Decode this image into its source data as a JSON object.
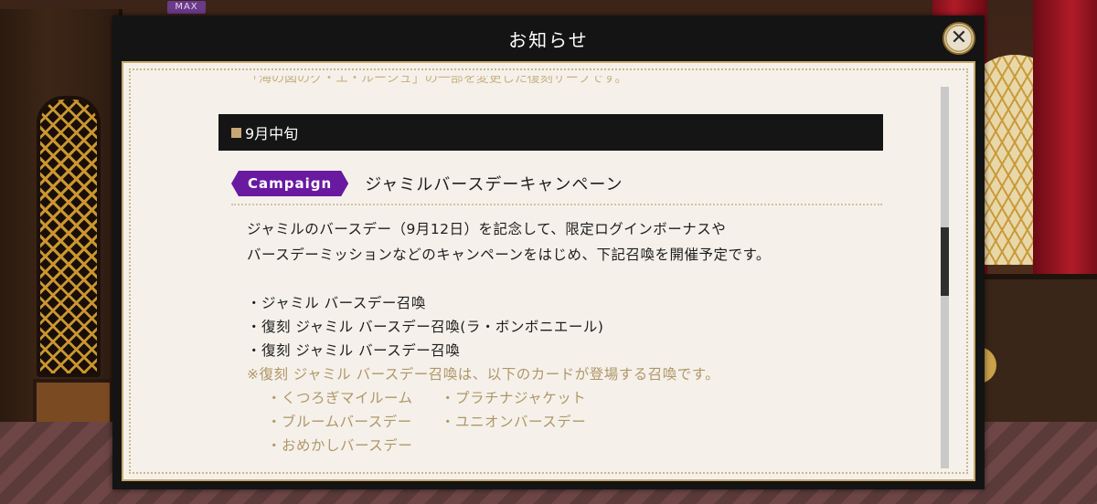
{
  "hud": {
    "max_badge": "MAX"
  },
  "dialog": {
    "title": "お知らせ",
    "close_symbol": "✕",
    "truncated_line": "「海の図のグ・エ・ルーシュ」の一部を変更した復刻サーフです。",
    "section": {
      "title": "9月中旬"
    },
    "campaign": {
      "tag": "Campaign",
      "title": "ジャミルバースデーキャンペーン",
      "description": [
        "ジャミルのバースデー（9月12日）を記念して、限定ログインボーナスや",
        "バースデーミッションなどのキャンペーンをはじめ、下記召喚を開催予定です。"
      ],
      "summons": [
        "・ジャミル バースデー召喚",
        "・復刻 ジャミル バースデー召喚(ラ・ボンボニエール)",
        "・復刻 ジャミル バースデー召喚"
      ],
      "note": "※復刻 ジャミル バースデー召喚は、以下のカードが登場する召喚です。",
      "cards": [
        "・くつろぎマイルーム",
        "・プラチナジャケット",
        "・ブルームバースデー",
        "・ユニオンバースデー",
        "・おめかしバースデー"
      ]
    },
    "scroll_position": 0.45
  },
  "colors": {
    "dialog_bg": "#141414",
    "panel_bg": "#f5f1ea",
    "campaign_tag": "#6a1aa0",
    "note_text": "#b09668",
    "section_square": "#c7a773"
  }
}
